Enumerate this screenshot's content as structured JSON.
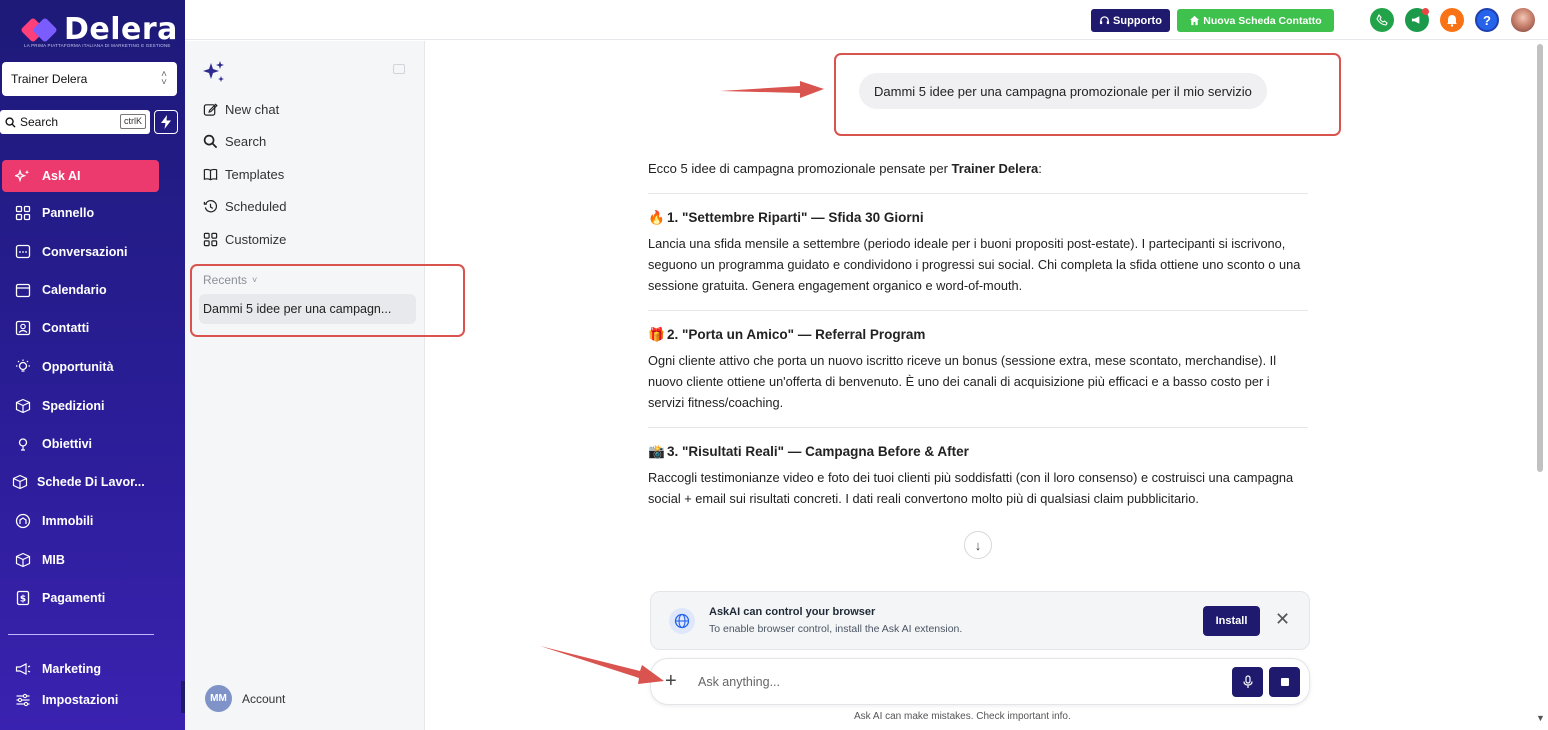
{
  "brand": {
    "name": "Delera",
    "tagline": "LA PRIMA PIATTAFORMA ITALIANA DI MARKETING E GESTIONE"
  },
  "account_selector": {
    "value": "Trainer Delera"
  },
  "sidebar_search": {
    "placeholder": "Search",
    "shortcut": "ctrlK"
  },
  "sidebar": {
    "items": [
      {
        "label": "Ask AI",
        "icon": "sparkle-icon"
      },
      {
        "label": "Pannello",
        "icon": "dashboard-icon"
      },
      {
        "label": "Conversazioni",
        "icon": "chat-icon"
      },
      {
        "label": "Calendario",
        "icon": "calendar-icon"
      },
      {
        "label": "Contatti",
        "icon": "contact-icon"
      },
      {
        "label": "Opportunità",
        "icon": "lightbulb-icon"
      },
      {
        "label": "Spedizioni",
        "icon": "box-icon"
      },
      {
        "label": "Obiettivi",
        "icon": "target-icon"
      },
      {
        "label": "Schede Di Lavor...",
        "icon": "cube-icon"
      },
      {
        "label": "Immobili",
        "icon": "building-icon"
      },
      {
        "label": "MIB",
        "icon": "cube-icon"
      },
      {
        "label": "Pagamenti",
        "icon": "invoice-icon"
      }
    ],
    "bottom_items": [
      {
        "label": "Marketing",
        "icon": "megaphone-icon"
      },
      {
        "label": "Impostazioni",
        "icon": "sliders-icon"
      }
    ]
  },
  "topbar": {
    "support_label": "Supporto",
    "new_contact_label": "Nuova Scheda Contatto",
    "colors": {
      "support": "#1f1a6d",
      "new_contact": "#3fc24d",
      "phone": "#22a34a",
      "bell": "#f97316",
      "help": "#2563eb"
    }
  },
  "history": {
    "items": [
      {
        "label": "New chat",
        "icon": "edit-icon"
      },
      {
        "label": "Search",
        "icon": "search-icon"
      },
      {
        "label": "Templates",
        "icon": "book-icon"
      },
      {
        "label": "Scheduled",
        "icon": "clock-icon"
      },
      {
        "label": "Customize",
        "icon": "grid-icon"
      }
    ],
    "recents_label": "Recents",
    "recent_chat": "Dammi 5 idee per una campagn...",
    "account_initials": "MM",
    "account_label": "Account"
  },
  "chat": {
    "user_message": "Dammi 5 idee per una campagna promozionale per il mio servizio",
    "intro_prefix": "Ecco 5 idee di campagna promozionale pensate per ",
    "intro_bold": "Trainer Delera",
    "intro_suffix": ":",
    "ideas": [
      {
        "emoji": "🔥",
        "title": "1. \"Settembre Riparti\" — Sfida 30 Giorni",
        "body": "Lancia una sfida mensile a settembre (periodo ideale per i buoni propositi post-estate). I partecipanti si iscrivono, seguono un programma guidato e condividono i progressi sui social. Chi completa la sfida ottiene uno sconto o una sessione gratuita. Genera engagement organico e word-of-mouth."
      },
      {
        "emoji": "🎁",
        "title": "2. \"Porta un Amico\" — Referral Program",
        "body": "Ogni cliente attivo che porta un nuovo iscritto riceve un bonus (sessione extra, mese scontato, merchandise). Il nuovo cliente ottiene un'offerta di benvenuto. È uno dei canali di acquisizione più efficaci e a basso costo per i servizi fitness/coaching."
      },
      {
        "emoji": "📸",
        "title": "3. \"Risultati Reali\" — Campagna Before & After",
        "body": "Raccogli testimonianze video e foto dei tuoi clienti più soddisfatti (con il loro consenso) e costruisci una campagna social + email sui risultati concreti. I dati reali convertono molto più di qualsiasi claim pubblicitario."
      }
    ]
  },
  "extension_banner": {
    "title": "AskAI can control your browser",
    "description": "To enable browser control, install the Ask AI extension.",
    "install_label": "Install"
  },
  "composer": {
    "placeholder": "Ask anything...",
    "disclaimer": "Ask AI can make mistakes. Check important info."
  },
  "annotation_color": "#d9534f"
}
